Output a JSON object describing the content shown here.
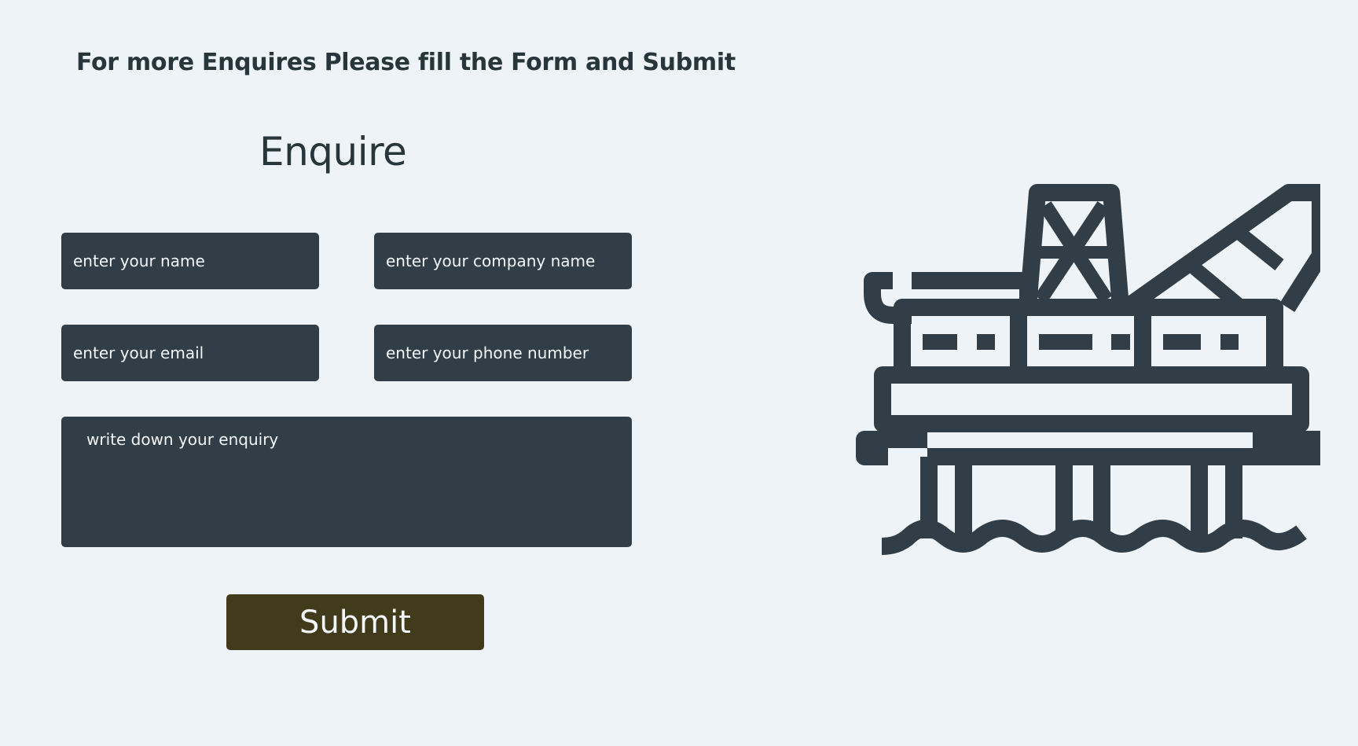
{
  "header": {
    "intro_text": "For more Enquires Please fill the Form and Submit",
    "form_title": "Enquire"
  },
  "form": {
    "name_placeholder": "enter your name",
    "company_placeholder": "enter your company name",
    "email_placeholder": "enter your email",
    "phone_placeholder": "enter your phone number",
    "enquiry_placeholder": "write down your enquiry",
    "submit_label": "Submit"
  },
  "illustration": {
    "icon": "oil-rig-icon",
    "color": "#313e47"
  },
  "colors": {
    "background": "#eef3f7",
    "field": "#313e47",
    "submit": "#413a1b",
    "text": "#26363b"
  }
}
